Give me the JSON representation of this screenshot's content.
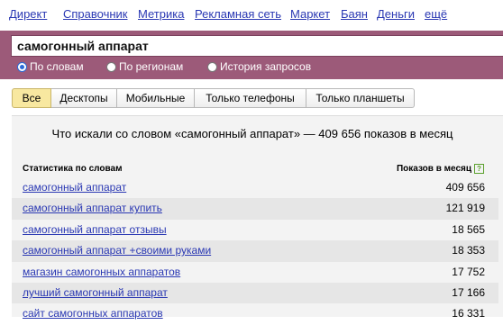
{
  "nav": {
    "items": [
      "Директ",
      "Справочник",
      "Метрика",
      "Рекламная сеть",
      "Маркет",
      "Баян",
      "Деньги",
      "ещё"
    ]
  },
  "search": {
    "query": "самогонный аппарат",
    "modes": [
      {
        "label": "По словам",
        "selected": true
      },
      {
        "label": "По регионам",
        "selected": false
      },
      {
        "label": "История запросов",
        "selected": false
      }
    ]
  },
  "tabs": [
    "Все",
    "Десктопы",
    "Мобильные",
    "Только телефоны",
    "Только планшеты"
  ],
  "active_tab": "Все",
  "results": {
    "title": "Что искали со словом «самогонный аппарат» — 409 656 показов в месяц",
    "col_phrase": "Статистика по словам",
    "col_count": "Показов в месяц",
    "help_icon": "?",
    "rows": [
      {
        "phrase": "самогонный аппарат",
        "count": "409 656"
      },
      {
        "phrase": "самогонный аппарат купить",
        "count": "121 919"
      },
      {
        "phrase": "самогонный аппарат отзывы",
        "count": "18 565"
      },
      {
        "phrase": "самогонный аппарат +своими руками",
        "count": "18 353"
      },
      {
        "phrase": "магазин самогонных аппаратов",
        "count": "17 752"
      },
      {
        "phrase": "лучший самогонный аппарат",
        "count": "17 166"
      },
      {
        "phrase": "сайт самогонных аппаратов",
        "count": "16 331"
      }
    ]
  },
  "colors": {
    "band": "#9c5a79",
    "link": "#2a38b3",
    "active_tab": "#f8e8a0"
  }
}
